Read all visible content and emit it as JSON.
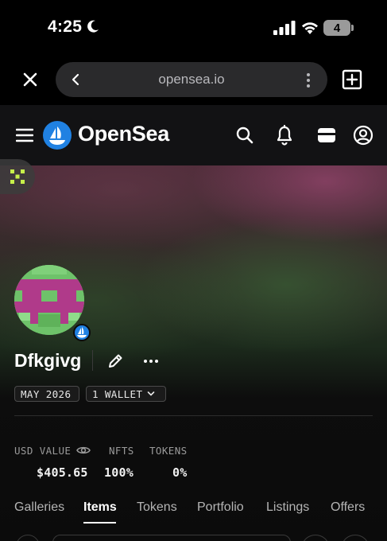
{
  "status_bar": {
    "time": "4:25",
    "battery": "4",
    "icons": [
      "moon-icon",
      "signal-icon",
      "wifi-icon",
      "battery-icon"
    ]
  },
  "browser": {
    "url": "opensea.io",
    "icons": [
      "close-icon",
      "back-icon",
      "kebab-icon",
      "new-tab-icon"
    ]
  },
  "header": {
    "brand": "OpenSea",
    "brand_color": "#2081e2",
    "icons": [
      "menu-icon",
      "search-icon",
      "bell-icon",
      "wallet-icon",
      "profile-icon"
    ]
  },
  "profile": {
    "name": "Dfkgivg",
    "joined": "MAY 2026",
    "wallets": "1 WALLET",
    "verified": true
  },
  "stats": [
    {
      "label": "USD VALUE",
      "value": "$405.65"
    },
    {
      "label": "NFTS",
      "value": "100%"
    },
    {
      "label": "TOKENS",
      "value": "0%"
    }
  ],
  "tabs": [
    {
      "label": "Galleries",
      "active": false
    },
    {
      "label": "Items",
      "active": true
    },
    {
      "label": "Tokens",
      "active": false
    },
    {
      "label": "Portfolio",
      "active": false
    },
    {
      "label": "Listings",
      "active": false
    },
    {
      "label": "Offers",
      "active": false
    }
  ],
  "colors": {
    "accent_green": "#c6f04a",
    "avatar_green": "#6ec26a",
    "avatar_magenta": "#b03a8a"
  }
}
